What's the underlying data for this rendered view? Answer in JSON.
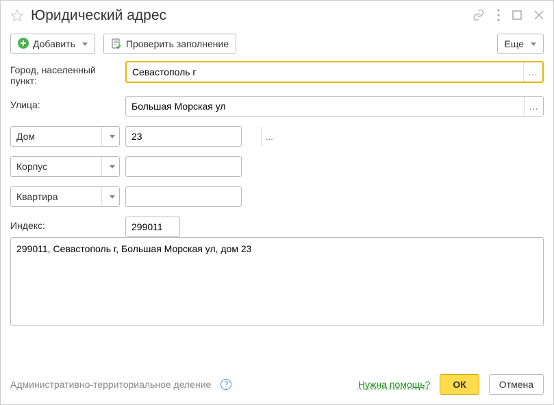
{
  "title": "Юридический адрес",
  "toolbar": {
    "add_label": "Добавить",
    "check_label": "Проверить заполнение",
    "more_label": "Еще"
  },
  "form": {
    "city_label": "Город, населенный пункт:",
    "city_value": "Севастополь г",
    "street_label": "Улица:",
    "street_value": "Большая Морская ул",
    "house_type": "Дом",
    "house_value": "23",
    "korpus_type": "Корпус",
    "korpus_value": "",
    "flat_type": "Квартира",
    "flat_value": "",
    "index_label": "Индекс:",
    "index_value": "299011",
    "full_address": "299011, Севастополь г, Большая Морская ул, дом 23"
  },
  "footer": {
    "admin_link": "Административно-территориальное деление",
    "need_help": "Нужна помощь?",
    "ok": "ОК",
    "cancel": "Отмена"
  }
}
